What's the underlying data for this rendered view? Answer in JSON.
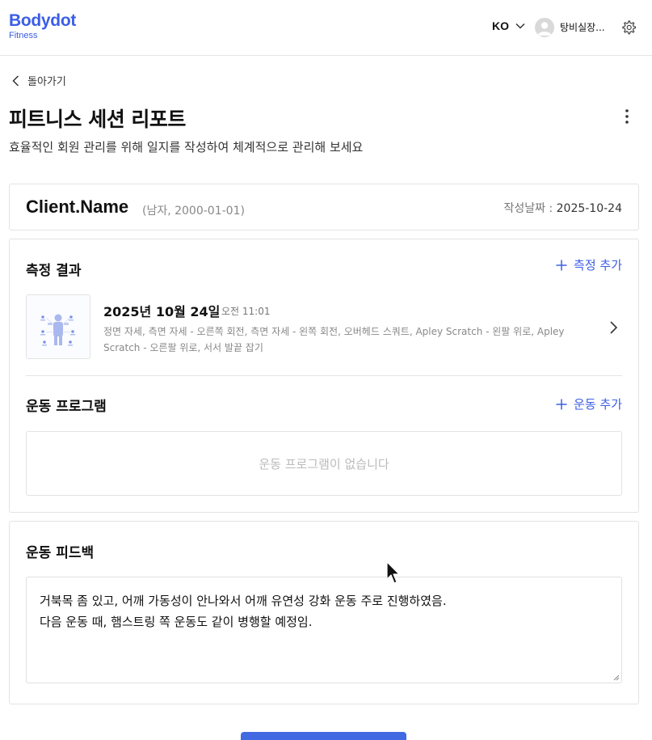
{
  "header": {
    "logo_main": "Bodydot",
    "logo_sub": "Fitness",
    "language": "KO",
    "username": "탕비실장...",
    "icons": [
      "chevron-down-icon",
      "user-icon",
      "gear-icon"
    ]
  },
  "page": {
    "back_label": "돌아가기",
    "title": "피트니스 세션 리포트",
    "subtitle": "효율적인 회원 관리를 위해 일지를 작성하여 체계적으로 관리해 보세요"
  },
  "client": {
    "name": "Client.Name",
    "meta": "(남자, 2000-01-01)",
    "date_label": "작성날짜 : ",
    "date_value": "2025-10-24"
  },
  "measurement": {
    "title": "측정 결과",
    "add_label": "측정 추가",
    "entry": {
      "date": "2025년 10월 24일",
      "time": "오전 11:01",
      "items": "정면 자세, 측면 자세 - 오른쪽 회전, 측면 자세 - 왼쪽 회전, 오버헤드 스쿼트, Apley Scratch - 왼팔 위로, Apley Scratch - 오른팔 위로, 서서 발끝 잡기"
    }
  },
  "program": {
    "title": "운동 프로그램",
    "add_label": "운동 추가",
    "empty_text": "운동 프로그램이 없습니다"
  },
  "feedback": {
    "title": "운동 피드백",
    "line1": "거북목 좀 있고, 어깨 가동성이 안나와서 어깨 유연성 강화 운동 주로 진행하였음.",
    "line2": "다음 운동 때, 햄스트링 쪽 운동도 같이 병행할 예정임."
  },
  "colors": {
    "accent": "#3b5ee6",
    "primary_button": "#4169e1",
    "border": "#e3e3e3"
  }
}
